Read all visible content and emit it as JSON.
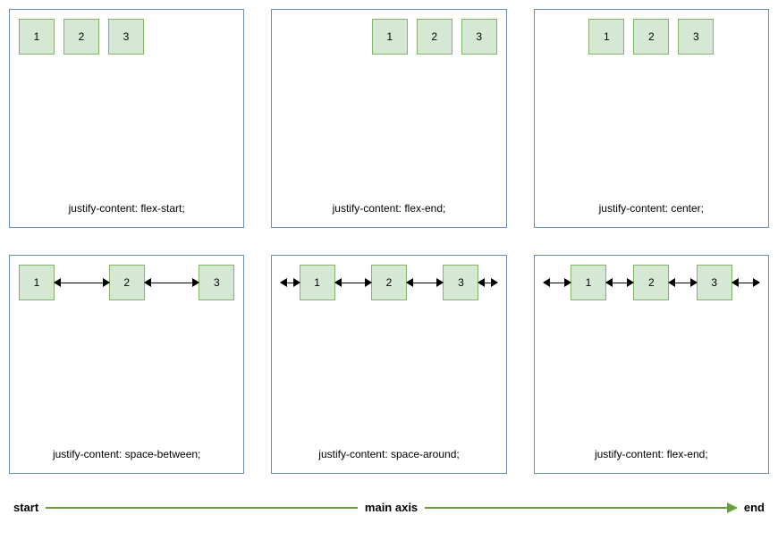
{
  "panels": [
    {
      "caption": "justify-content: flex-start;",
      "mode": "start",
      "items": [
        "1",
        "2",
        "3"
      ]
    },
    {
      "caption": "justify-content: flex-end;",
      "mode": "end",
      "items": [
        "1",
        "2",
        "3"
      ]
    },
    {
      "caption": "justify-content: center;",
      "mode": "center",
      "items": [
        "1",
        "2",
        "3"
      ]
    },
    {
      "caption": "justify-content: space-between;",
      "mode": "between",
      "items": [
        "1",
        "2",
        "3"
      ]
    },
    {
      "caption": "justify-content: space-around;",
      "mode": "around",
      "items": [
        "1",
        "2",
        "3"
      ]
    },
    {
      "caption": "justify-content: flex-end;",
      "mode": "evenly",
      "items": [
        "1",
        "2",
        "3"
      ]
    }
  ],
  "axis": {
    "start": "start",
    "label": "main axis",
    "end": "end"
  }
}
